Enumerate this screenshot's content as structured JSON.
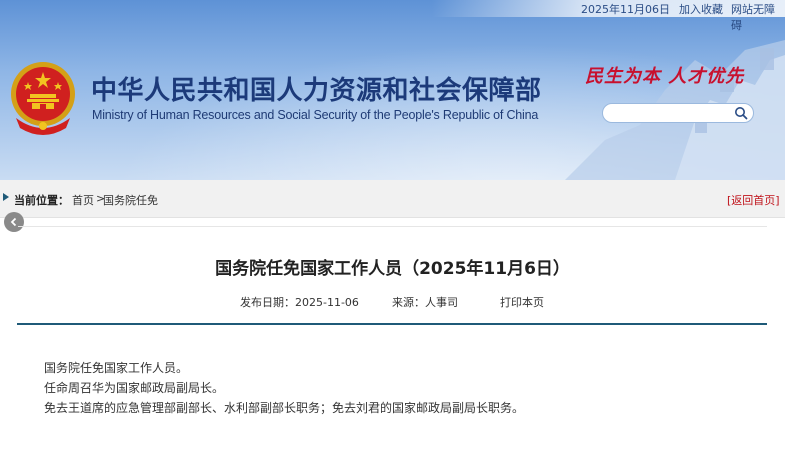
{
  "header": {
    "date": "2025年11月06日",
    "favorite_link": "加入收藏",
    "accessibility_link": "网站无障碍",
    "ministry_name_cn": "中华人民共和国人力资源和社会保障部",
    "ministry_name_en": "Ministry of Human Resources and Social Security of the People's Republic of China",
    "slogan": "民生为本 人才优先",
    "search": {
      "placeholder": "",
      "value": ""
    }
  },
  "breadcrumb": {
    "label": "当前位置：",
    "home": "首页",
    "separator": ">",
    "section": "国务院任免",
    "back": "[返回首页]"
  },
  "article": {
    "title": "国务院任免国家工作人员（2025年11月6日）",
    "publish_date": "发布日期：2025-11-06",
    "source": "来源：人事司",
    "print": "打印本页",
    "paragraphs": [
      "国务院任免国家工作人员。",
      "任命周召华为国家邮政局副局长。",
      "免去王道席的应急管理部副部长、水利部副部长职务；免去刘君的国家邮政局副局长职务。"
    ]
  },
  "colors": {
    "accent": "#1f5a78",
    "title_blue": "#1c3a7a",
    "slogan_red": "#c8102e",
    "back_red": "#c0141c"
  }
}
